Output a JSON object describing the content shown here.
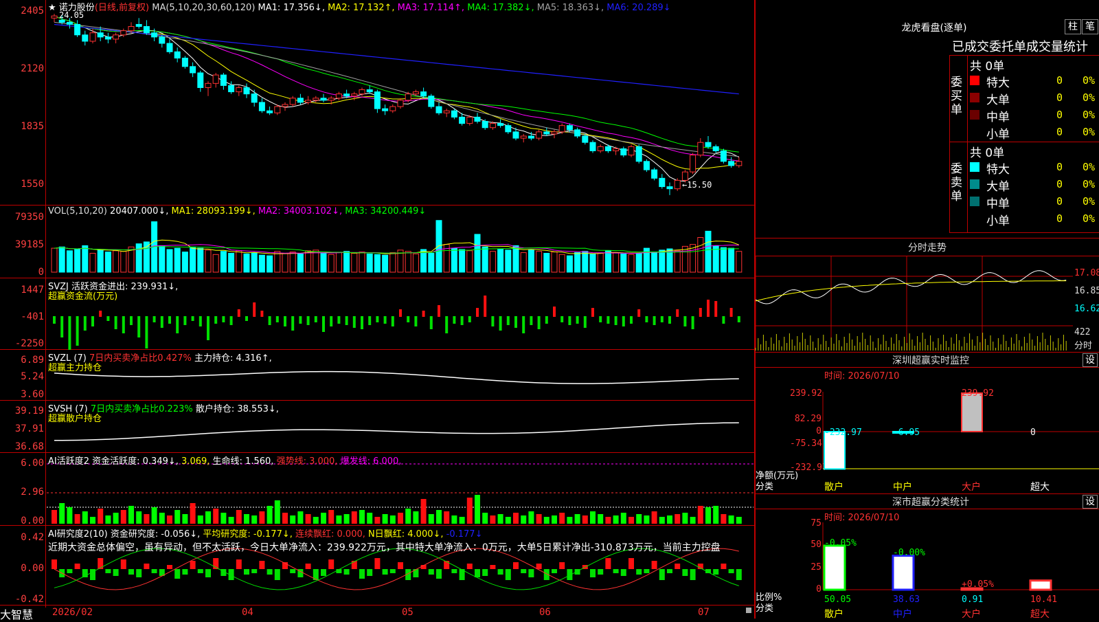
{
  "main": {
    "header": {
      "stock_name": "诺力股份",
      "mode": "(日线,前复权)",
      "ma_spec": "MA(5,10,20,30,60,120)",
      "ma1": "MA1: 17.356↓,",
      "ma2": "MA2: 17.132↑,",
      "ma3": "MA3: 17.114↑,",
      "ma4": "MA4: 17.382↓,",
      "ma5": "MA5: 18.363↓,",
      "ma6": "MA6: 20.289↓"
    },
    "price_axis": [
      "2405",
      "2120",
      "1835",
      "1550"
    ],
    "high_marker": "24.05",
    "low_marker": "←15.50",
    "price_ohlc": [
      [
        23.9,
        24.1,
        23.7,
        24.0
      ],
      [
        23.8,
        24.05,
        23.6,
        23.7
      ],
      [
        23.7,
        23.9,
        23.4,
        23.6
      ],
      [
        23.6,
        23.8,
        23.0,
        23.1
      ],
      [
        23.1,
        23.3,
        22.6,
        22.8
      ],
      [
        22.8,
        23.4,
        22.7,
        23.2
      ],
      [
        23.2,
        23.5,
        22.8,
        23.0
      ],
      [
        23.0,
        23.2,
        22.7,
        22.9
      ],
      [
        22.9,
        23.2,
        22.7,
        23.1
      ],
      [
        23.1,
        23.4,
        23.0,
        23.3
      ],
      [
        23.3,
        23.7,
        23.2,
        23.5
      ],
      [
        23.6,
        23.9,
        23.4,
        23.5
      ],
      [
        23.5,
        23.8,
        23.1,
        23.2
      ],
      [
        23.2,
        23.4,
        22.8,
        23.0
      ],
      [
        23.0,
        23.1,
        22.5,
        22.7
      ],
      [
        22.7,
        22.9,
        22.2,
        22.3
      ],
      [
        22.3,
        22.5,
        21.8,
        22.0
      ],
      [
        22.0,
        22.1,
        21.5,
        21.6
      ],
      [
        21.6,
        21.8,
        21.1,
        21.3
      ],
      [
        21.3,
        21.4,
        20.4,
        20.6
      ],
      [
        20.6,
        20.9,
        20.2,
        20.8
      ],
      [
        20.8,
        21.3,
        20.6,
        21.2
      ],
      [
        21.2,
        21.3,
        20.5,
        20.7
      ],
      [
        20.7,
        20.9,
        20.3,
        20.4
      ],
      [
        20.4,
        20.7,
        20.2,
        20.6
      ],
      [
        20.6,
        20.8,
        20.1,
        20.3
      ],
      [
        20.3,
        20.5,
        19.7,
        19.9
      ],
      [
        19.9,
        20.1,
        19.4,
        19.5
      ],
      [
        19.5,
        19.7,
        19.3,
        19.4
      ],
      [
        19.4,
        19.8,
        19.3,
        19.7
      ],
      [
        19.7,
        19.9,
        19.5,
        19.8
      ],
      [
        19.8,
        20.2,
        19.7,
        20.1
      ],
      [
        20.1,
        20.3,
        19.8,
        19.9
      ],
      [
        19.9,
        20.2,
        19.8,
        20.0
      ],
      [
        20.0,
        20.2,
        19.9,
        20.1
      ],
      [
        20.1,
        20.3,
        19.9,
        20.0
      ],
      [
        20.0,
        20.2,
        19.8,
        20.1
      ],
      [
        20.1,
        20.4,
        20.0,
        20.3
      ],
      [
        20.3,
        20.5,
        20.1,
        20.2
      ],
      [
        20.2,
        20.4,
        20.0,
        20.3
      ],
      [
        20.3,
        20.6,
        20.2,
        20.5
      ],
      [
        20.5,
        20.7,
        20.3,
        20.4
      ],
      [
        20.4,
        20.5,
        19.4,
        19.6
      ],
      [
        19.6,
        19.8,
        19.3,
        19.5
      ],
      [
        19.5,
        19.8,
        19.4,
        19.7
      ],
      [
        19.7,
        20.1,
        19.6,
        20.0
      ],
      [
        20.0,
        20.4,
        19.9,
        20.3
      ],
      [
        20.3,
        20.5,
        20.2,
        20.4
      ],
      [
        20.4,
        20.6,
        20.1,
        20.2
      ],
      [
        20.2,
        20.3,
        19.6,
        19.7
      ],
      [
        19.7,
        19.9,
        19.3,
        19.4
      ],
      [
        19.4,
        19.6,
        19.2,
        19.5
      ],
      [
        19.5,
        19.6,
        19.1,
        19.2
      ],
      [
        19.2,
        19.4,
        18.8,
        18.9
      ],
      [
        18.9,
        19.3,
        18.8,
        19.2
      ],
      [
        19.2,
        19.4,
        18.9,
        19.0
      ],
      [
        19.0,
        19.1,
        18.6,
        18.7
      ],
      [
        18.7,
        19.0,
        18.6,
        18.9
      ],
      [
        18.9,
        19.1,
        18.7,
        18.8
      ],
      [
        18.8,
        18.9,
        18.4,
        18.5
      ],
      [
        18.5,
        18.7,
        18.1,
        18.2
      ],
      [
        18.2,
        18.4,
        18.0,
        18.3
      ],
      [
        18.3,
        18.5,
        18.1,
        18.2
      ],
      [
        18.2,
        18.6,
        18.1,
        18.5
      ],
      [
        18.5,
        18.7,
        18.3,
        18.4
      ],
      [
        18.4,
        18.6,
        18.2,
        18.5
      ],
      [
        18.5,
        18.9,
        18.4,
        18.8
      ],
      [
        18.8,
        18.9,
        18.5,
        18.6
      ],
      [
        18.6,
        18.7,
        18.2,
        18.3
      ],
      [
        18.3,
        18.4,
        17.9,
        18.0
      ],
      [
        18.0,
        18.1,
        17.5,
        17.6
      ],
      [
        17.6,
        17.9,
        17.5,
        17.8
      ],
      [
        17.8,
        17.9,
        17.5,
        17.6
      ],
      [
        17.6,
        17.8,
        17.4,
        17.7
      ],
      [
        17.7,
        17.8,
        17.3,
        17.4
      ],
      [
        17.4,
        17.9,
        17.3,
        17.8
      ],
      [
        17.8,
        17.9,
        17.0,
        17.1
      ],
      [
        17.1,
        17.2,
        16.6,
        16.7
      ],
      [
        16.7,
        16.8,
        16.2,
        16.3
      ],
      [
        16.3,
        16.5,
        15.8,
        15.9
      ],
      [
        15.9,
        16.1,
        15.5,
        15.8
      ],
      [
        15.8,
        16.3,
        15.7,
        16.2
      ],
      [
        16.2,
        16.7,
        16.1,
        16.6
      ],
      [
        16.6,
        17.5,
        16.5,
        17.4
      ],
      [
        17.4,
        18.2,
        17.3,
        18.0
      ],
      [
        18.0,
        18.3,
        17.7,
        17.8
      ],
      [
        17.8,
        17.9,
        17.5,
        17.6
      ],
      [
        17.6,
        17.7,
        17.0,
        17.1
      ],
      [
        17.1,
        17.3,
        16.8,
        16.9
      ],
      [
        16.9,
        17.3,
        16.8,
        17.1
      ]
    ],
    "vol_header": {
      "spec": "VOL(5,10,20)",
      "v": "20407.000↓,",
      "ma1": "MA1: 28093.199↓,",
      "ma2": "MA2: 34003.102↓,",
      "ma3": "MA3: 34200.449↓"
    },
    "vol_axis": [
      "79350",
      "39185",
      "0"
    ],
    "volumes": [
      38,
      40,
      34,
      36,
      42,
      30,
      35,
      32,
      34,
      33,
      40,
      45,
      48,
      80,
      42,
      36,
      38,
      32,
      40,
      38,
      35,
      28,
      33,
      30,
      34,
      29,
      31,
      27,
      26,
      33,
      30,
      32,
      29,
      34,
      35,
      30,
      28,
      31,
      33,
      30,
      32,
      29,
      28,
      27,
      31,
      35,
      33,
      29,
      36,
      30,
      82,
      44,
      38,
      36,
      34,
      60,
      40,
      33,
      37,
      35,
      42,
      31,
      36,
      33,
      30,
      32,
      28,
      26,
      31,
      33,
      29,
      30,
      34,
      31,
      29,
      28,
      30,
      38,
      32,
      35,
      37,
      34,
      41,
      44,
      55,
      65,
      42,
      39,
      38,
      33
    ],
    "svzj": {
      "header": "SVZJ  活跃资金进出: 239.931↓,",
      "sub": "超赢资金流(万元)",
      "axis": [
        "1447",
        "-401",
        "-2250"
      ]
    },
    "svzl": {
      "header_a": "SVZL (7)",
      "header_b": "7日内买卖净占比0.427%",
      "header_c": "主力持仓: 4.316↑,",
      "sub": "超赢主力持仓",
      "axis": [
        "6.89",
        "5.24",
        "3.60"
      ]
    },
    "svsh": {
      "header_a": "SVSH (7)",
      "header_b": "7日内买卖净占比0.223%",
      "header_c": "散户持仓: 38.553↓,",
      "sub": "超赢散户持仓",
      "axis": [
        "39.19",
        "37.91",
        "36.68"
      ]
    },
    "ai_active": {
      "header_a": "AI活跃度2",
      "header_b": "资金活跃度: 0.349↓,",
      "header_c": "3.069,",
      "header_d": "生命线: 1.560,",
      "header_e": "强势线: 3.000,",
      "header_f": "爆发线: 6.000,",
      "axis": [
        "6.00",
        "2.96",
        "0.00"
      ]
    },
    "ai_research": {
      "header_a": "AI研究度2(10)",
      "header_b": "资金研究度: -0.056↓,",
      "header_c": "平均研究度: -0.177↓,",
      "header_d": "连续飘红: 0.000,",
      "header_e": "N日飘红: 4.000↓,",
      "header_f": "-0.177↓",
      "comment": "近期大资金总体偏空，虽有异动，但不太活跃，今日大单净流入：239.922万元，其中特大单净流入：0万元，大单5日累计净出-310.873万元，当前主力控盘",
      "axis": [
        "0.42",
        "0.00",
        "-0.42"
      ]
    },
    "date_axis": [
      "2026/02",
      "04",
      "05",
      "06",
      "07"
    ],
    "brand": "大智慧"
  },
  "right": {
    "lhb_title": "龙虎看盘(逐单)",
    "tab_col": "柱",
    "tab_pen": "笔",
    "table_header": "已成交委托单成交量统计",
    "buy": {
      "side_label": "委买单",
      "total": "共 0单",
      "rows": [
        {
          "name": "特大",
          "count": "0",
          "pct": "0%",
          "color": "#ff0000"
        },
        {
          "name": "大单",
          "count": "0",
          "pct": "0%",
          "color": "#8b0000"
        },
        {
          "name": "中单",
          "count": "0",
          "pct": "0%",
          "color": "#6b0000"
        },
        {
          "name": "小单",
          "count": "0",
          "pct": "0%",
          "color": "#000000"
        }
      ]
    },
    "sell": {
      "side_label": "委卖单",
      "total": "共 0单",
      "rows": [
        {
          "name": "特大",
          "count": "0",
          "pct": "0%",
          "color": "#00ffff"
        },
        {
          "name": "大单",
          "count": "0",
          "pct": "0%",
          "color": "#008b8b"
        },
        {
          "name": "中单",
          "count": "0",
          "pct": "0%",
          "color": "#007070"
        },
        {
          "name": "小单",
          "count": "0",
          "pct": "0%",
          "color": "#000000"
        }
      ]
    },
    "intraday": {
      "title": "分时走势",
      "axis": [
        "17.08",
        "16.85",
        "16.62"
      ],
      "vol_label": "422",
      "unit": "分时"
    },
    "sz_monitor": {
      "title": "深圳超赢实时监控",
      "set": "设",
      "time": "时间: 2026/07/10",
      "axis": [
        "239.92",
        "82.29",
        "0",
        "-75.34",
        "-232.97"
      ],
      "unit_a": "净额(万元)",
      "unit_b": "分类",
      "categories": [
        "散户",
        "中户",
        "大户",
        "超大"
      ],
      "values": [
        -232.97,
        -6.95,
        239.92,
        0
      ],
      "labels": [
        "-232.97",
        "-6.95",
        "239.92",
        "0"
      ]
    },
    "sz_class": {
      "title": "深市超赢分类统计",
      "set": "设",
      "time": "时间: 2026/07/10",
      "axis": [
        "75",
        "50",
        "25",
        "0"
      ],
      "unit_a": "比例%",
      "unit_b": "分类",
      "categories": [
        "散户",
        "中户",
        "大户",
        "超大"
      ],
      "values": [
        50.05,
        38.63,
        0.91,
        10.41
      ],
      "value_labels": [
        "50.05",
        "38.63",
        "0.91",
        "10.41"
      ],
      "change_labels": [
        "-0.05%",
        "-0.00%",
        "+0.05%",
        ""
      ]
    }
  },
  "colors": {
    "up": "#ff3232",
    "down": "#00ffff",
    "grid": "#c00000",
    "ma1": "#ffffff",
    "ma2": "#ffff00",
    "ma3": "#ff00ff",
    "ma4": "#00ff00",
    "ma5": "#a0a0a0",
    "ma6": "#2020ff"
  }
}
